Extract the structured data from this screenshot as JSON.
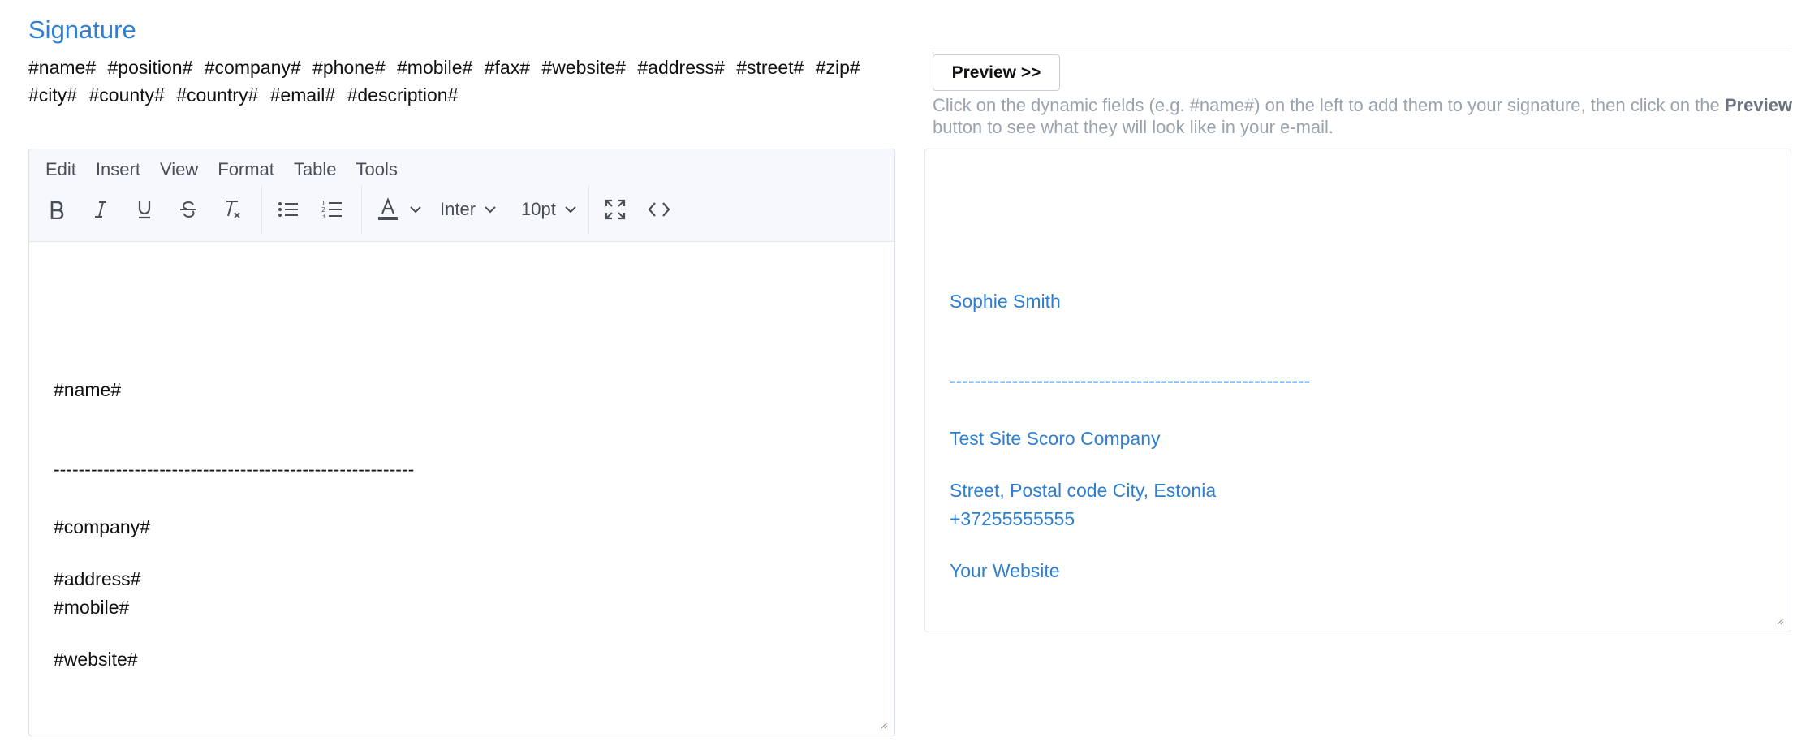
{
  "section": {
    "title": "Signature"
  },
  "dynamic_fields": [
    "#name#",
    "#position#",
    "#company#",
    "#phone#",
    "#mobile#",
    "#fax#",
    "#website#",
    "#address#",
    "#street#",
    "#zip#",
    "#city#",
    "#county#",
    "#country#",
    "#email#",
    "#description#"
  ],
  "preview_button": {
    "label": "Preview  >>"
  },
  "help": {
    "text_before": "Click on the dynamic fields (e.g. #name#) on the left to add them to your signature, then click on the ",
    "bold": "Preview",
    "text_after": " button to see what they will look like in your e-mail."
  },
  "editor": {
    "menu": [
      "Edit",
      "Insert",
      "View",
      "Format",
      "Table",
      "Tools"
    ],
    "toolbar": {
      "icons": [
        "bold-icon",
        "italic-icon",
        "underline-icon",
        "strikethrough-icon",
        "clear-format-icon",
        "bullet-list-icon",
        "numbered-list-icon",
        "text-color-icon",
        "fullscreen-icon",
        "source-code-icon"
      ],
      "font_family": "Inter",
      "font_size": "10pt"
    },
    "content": {
      "name": "#name#",
      "divider": "----------------------------------------------------------",
      "company": "#company#",
      "address": "#address#",
      "mobile": "#mobile#",
      "website": "#website#"
    }
  },
  "preview": {
    "name": "Sophie Smith",
    "divider": "----------------------------------------------------------",
    "company": "Test Site Scoro Company",
    "address": "Street, Postal code City, Estonia",
    "mobile": "+37255555555",
    "website": "Your Website"
  },
  "colors": {
    "accent": "#2f7fd1",
    "muted": "#9aa3ad"
  }
}
